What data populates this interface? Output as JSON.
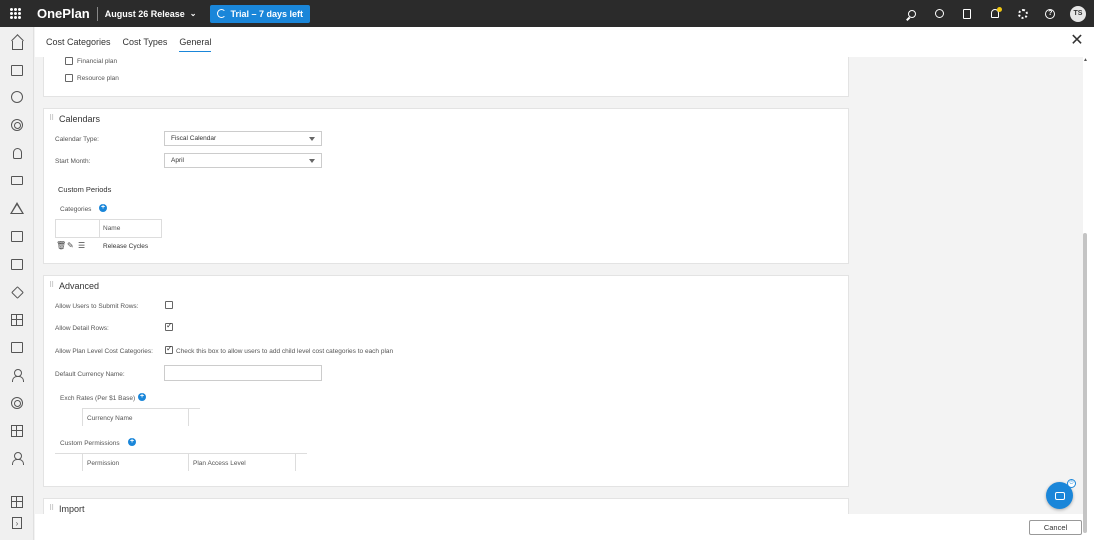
{
  "topbar": {
    "brand": "OnePlan",
    "release": "August 26 Release",
    "trial": "Trial – 7 days left",
    "avatar_initials": "TS"
  },
  "tabs": [
    "Cost Categories",
    "Cost Types",
    "General"
  ],
  "active_tab": "General",
  "plans_section": {
    "financial_plan": "Financial plan",
    "resource_plan": "Resource plan"
  },
  "calendars": {
    "title": "Calendars",
    "calendar_type_label": "Calendar Type:",
    "calendar_type_value": "Fiscal Calendar",
    "start_month_label": "Start Month:",
    "start_month_value": "April",
    "custom_periods_title": "Custom Periods",
    "categories_label": "Categories",
    "name_header": "Name",
    "row_name": "Release Cycles"
  },
  "advanced": {
    "title": "Advanced",
    "allow_submit_rows": "Allow Users to Submit Rows:",
    "allow_detail_rows": "Allow Detail Rows:",
    "allow_plan_level": "Allow Plan Level Cost Categories:",
    "plan_level_hint": "Check this box to allow users to add child level cost categories to each plan",
    "default_currency_label": "Default Currency Name:",
    "exch_rates_label": "Exch Rates (Per $1 Base)",
    "currency_name_header": "Currency Name",
    "custom_permissions_label": "Custom Permissions",
    "permission_header": "Permission",
    "plan_access_header": "Plan Access Level",
    "submit_rows_checked": false,
    "detail_rows_checked": true,
    "plan_level_checked": true
  },
  "import": {
    "title": "Import"
  },
  "footer": {
    "cancel": "Cancel"
  },
  "colors": {
    "accent": "#1a86d9",
    "topbar": "#2b2b2b",
    "notification": "#f2c811"
  }
}
